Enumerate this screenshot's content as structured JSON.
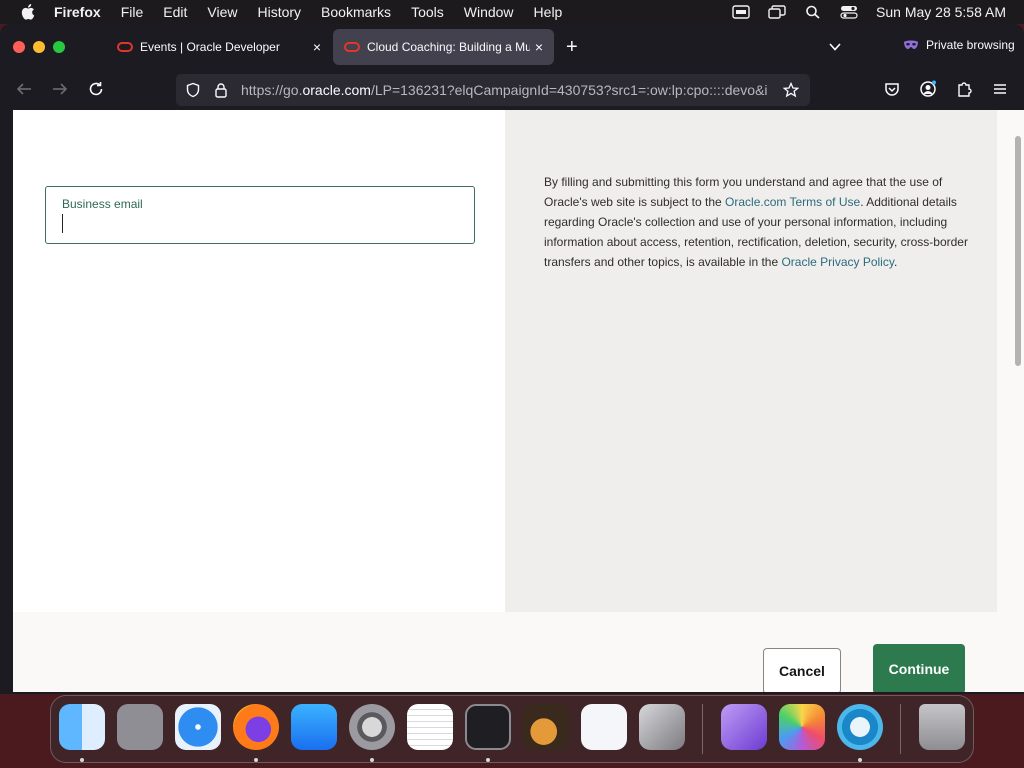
{
  "menubar": {
    "app_name": "Firefox",
    "items": [
      "File",
      "Edit",
      "View",
      "History",
      "Bookmarks",
      "Tools",
      "Window",
      "Help"
    ],
    "clock": "Sun May 28  5:58 AM"
  },
  "browser": {
    "tabs": [
      {
        "title": "Events | Oracle Developer",
        "active": false
      },
      {
        "title": "Cloud Coaching: Building a Multi",
        "active": true
      }
    ],
    "new_tab_symbol": "+",
    "close_symbol": "×",
    "private_label": "Private browsing",
    "url_prefix": "https://go.",
    "url_host": "oracle.com",
    "url_rest": "/LP=136231?elqCampaignId=430753?src1=:ow:lp:cpo::::devo&i"
  },
  "form": {
    "email_label": "Business email",
    "email_value": "",
    "legal_text_1": "By filling and submitting this form you understand and agree that the use of Oracle's web site is subject to the ",
    "terms_link": "Oracle.com Terms of Use",
    "legal_text_2": ". Additional details regarding Oracle's collection and use of your personal information, including information about access, retention, rectification, deletion, security, cross-border transfers and other topics, is available in the ",
    "privacy_link": "Oracle Privacy Policy",
    "legal_text_3": ".",
    "cancel_label": "Cancel",
    "continue_label": "Continue"
  },
  "colors": {
    "accent_green": "#2d7a4f",
    "link": "#2b6c7d",
    "field_border": "#3d6e58",
    "tab_logo": "#e3362b"
  },
  "dock": {
    "apps": [
      "finder-icon",
      "launchpad-icon",
      "safari-icon",
      "firefox-icon",
      "app-store-icon",
      "system-settings-icon",
      "textedit-icon",
      "terminal-icon",
      "garageband-icon",
      "vscode-icon",
      "boot-camp-icon",
      "visual-studio-icon",
      "photos-icon",
      "app-icon",
      "trash-icon"
    ]
  }
}
